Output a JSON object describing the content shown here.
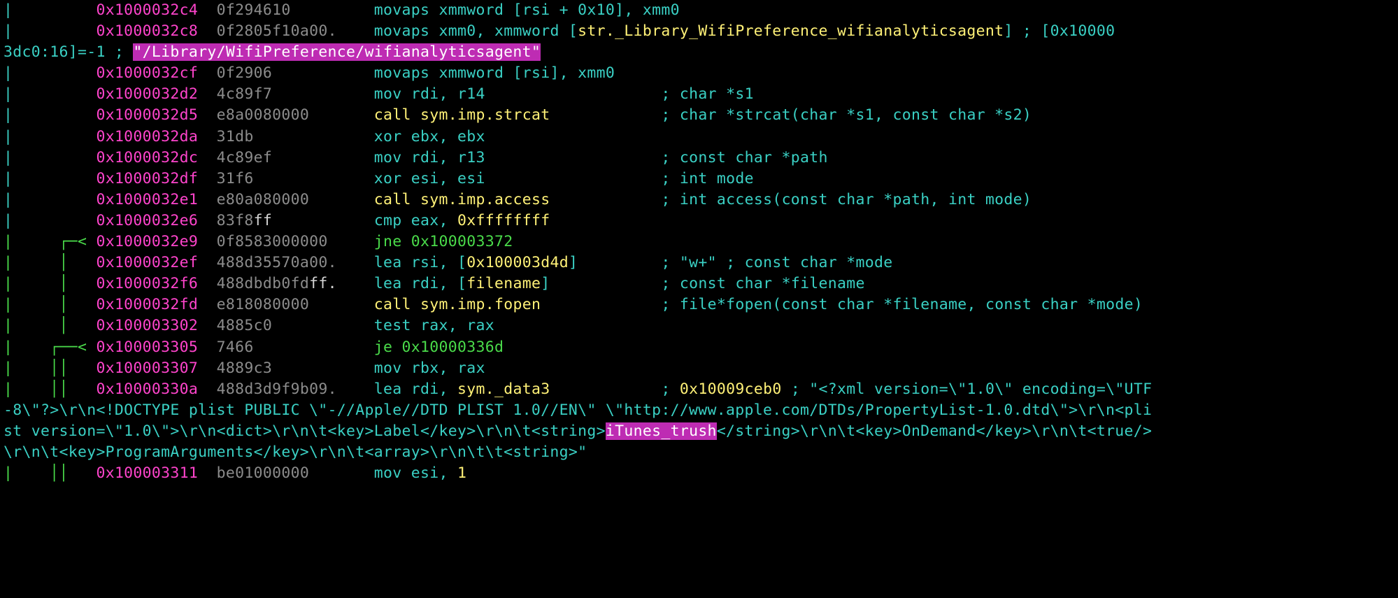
{
  "rows": [
    {
      "prefix": "|         ",
      "addr": "0x1000032c4",
      "bytes": "0f294610",
      "op": {
        "mnem": "movaps",
        "cls": "mnem",
        "rest": " xmmword [rsi + 0x10], xmm0"
      },
      "comment": ""
    },
    {
      "prefix": "|         ",
      "addr": "0x1000032c8",
      "bytes": "0f2805f10a00.",
      "op": {
        "mnem": "movaps",
        "cls": "mnem",
        "rest": " xmm0, xmmword [",
        "ref": "str._Library_WifiPreference_wifianalyticsagent",
        "close": "]"
      },
      "trailing": " ; [0x10000"
    },
    {
      "wrap": true,
      "text_a": "3dc0:16]=-1 ; ",
      "hl": "\"/Library/WifiPreference/wifianalyticsagent\""
    },
    {
      "prefix": "|         ",
      "addr": "0x1000032cf",
      "bytes": "0f2906",
      "op": {
        "mnem": "movaps",
        "cls": "mnem",
        "rest": " xmmword [rsi], xmm0"
      },
      "comment": ""
    },
    {
      "prefix": "|         ",
      "addr": "0x1000032d2",
      "bytes": "4c89f7",
      "op": {
        "mnem": "mov",
        "cls": "mnem",
        "rest": " rdi, r14"
      },
      "comment": "; char *s1"
    },
    {
      "prefix": "|         ",
      "addr": "0x1000032d5",
      "bytes": "e8a0080000",
      "op": {
        "mnem": "call",
        "cls": "call",
        "ref": "sym.imp.strcat"
      },
      "comment": "; char *strcat(char *s1, const char *s2)"
    },
    {
      "prefix": "|         ",
      "addr": "0x1000032da",
      "bytes": "31db",
      "op": {
        "mnem": "xor",
        "cls": "mnem",
        "rest": " ebx, ebx"
      },
      "comment": ""
    },
    {
      "prefix": "|         ",
      "addr": "0x1000032dc",
      "bytes": "4c89ef",
      "op": {
        "mnem": "mov",
        "cls": "mnem",
        "rest": " rdi, r13"
      },
      "comment": "; const char *path"
    },
    {
      "prefix": "|         ",
      "addr": "0x1000032df",
      "bytes": "31f6",
      "op": {
        "mnem": "xor",
        "cls": "mnem",
        "rest": " esi, esi"
      },
      "comment": "; int mode"
    },
    {
      "prefix": "|         ",
      "addr": "0x1000032e1",
      "bytes": "e80a080000",
      "op": {
        "mnem": "call",
        "cls": "call",
        "ref": "sym.imp.access"
      },
      "comment": "; int access(const char *path, int mode)"
    },
    {
      "prefix": "|         ",
      "addr": "0x1000032e6",
      "bytes_pre": "83f8",
      "bytes_bright": "ff",
      "op": {
        "mnem": "cmp",
        "cls": "mnem",
        "rest": " eax, ",
        "num": "0xffffffff"
      },
      "comment": ""
    },
    {
      "prefix": "|     ┌─< ",
      "prefix_cls": "jump",
      "addr": "0x1000032e9",
      "bytes": "0f8583000000",
      "op": {
        "mnem": "jne",
        "cls": "jump",
        "target": "0x100003372"
      },
      "comment": ""
    },
    {
      "prefix": "|     │   ",
      "prefix_cls": "jump",
      "addr": "0x1000032ef",
      "bytes": "488d35570a00.",
      "op": {
        "mnem": "lea",
        "cls": "mnem",
        "rest": " rsi, [",
        "num": "0x100003d4d",
        "close": "]"
      },
      "comment": "; \"w+\" ; const char *mode"
    },
    {
      "prefix": "|     │   ",
      "prefix_cls": "jump",
      "addr": "0x1000032f6",
      "bytes_pre": "488dbdb0fd",
      "bytes_bright": "ff.",
      "op": {
        "mnem": "lea",
        "cls": "mnem",
        "rest": " rdi, [",
        "ref": "filename",
        "close": "]"
      },
      "comment": "; const char *filename"
    },
    {
      "prefix": "|     │   ",
      "prefix_cls": "jump",
      "addr": "0x1000032fd",
      "bytes": "e818080000",
      "op": {
        "mnem": "call",
        "cls": "call",
        "ref": "sym.imp.fopen"
      },
      "comment": "; file*fopen(const char *filename, const char *mode)"
    },
    {
      "prefix": "|     │   ",
      "prefix_cls": "jump",
      "addr": "0x100003302",
      "bytes": "4885c0",
      "op": {
        "mnem": "test",
        "cls": "mnem",
        "rest": " rax, rax"
      },
      "comment": ""
    },
    {
      "prefix": "|    ┌──< ",
      "prefix_cls": "jump",
      "addr": "0x100003305",
      "bytes": "7466",
      "op": {
        "mnem": "je",
        "cls": "jump",
        "target": "0x10000336d"
      },
      "comment": ""
    },
    {
      "prefix": "|    ││   ",
      "prefix_cls": "jump",
      "addr": "0x100003307",
      "bytes": "4889c3",
      "op": {
        "mnem": "mov",
        "cls": "mnem",
        "rest": " rbx, rax"
      },
      "comment": ""
    },
    {
      "prefix": "|    ││   ",
      "prefix_cls": "jump",
      "addr": "0x10000330a",
      "bytes": "488d3d9f9b09.",
      "op": {
        "mnem": "lea",
        "cls": "mnem",
        "rest": " rdi, ",
        "ref": "sym._data3"
      },
      "long_comment_parts": [
        "; ",
        "0x10009ceb0",
        " ; \"<?xml version=\\\"1.0\\\" encoding=\\\"UTF"
      ]
    },
    {
      "wrap_multi": true,
      "text": "-8\\\"?>\\r\\n<!DOCTYPE plist PUBLIC \\\"-//Apple//DTD PLIST 1.0//EN\\\" \\\"http://www.apple.com/DTDs/PropertyList-1.0.dtd\\\">\\r\\n<pli"
    },
    {
      "wrap_multi": true,
      "text_a": "st version=\\\"1.0\\\">\\r\\n<dict>\\r\\n\\t<key>Label</key>\\r\\n\\t<string>",
      "hl": "iTunes_trush",
      "text_b": "</string>\\r\\n\\t<key>OnDemand</key>\\r\\n\\t<true/>"
    },
    {
      "wrap_multi": true,
      "text": "\\r\\n\\t<key>ProgramArguments</key>\\r\\n\\t<array>\\r\\n\\t\\t<string>\""
    },
    {
      "prefix": "|    ││   ",
      "prefix_cls": "jump",
      "addr": "0x100003311",
      "bytes": "be01000000",
      "op": {
        "mnem": "mov",
        "cls": "mnem",
        "rest": " esi, ",
        "num": "1"
      },
      "comment": ""
    }
  ],
  "cols": {
    "prefix": 10,
    "addr": 13,
    "bytes": 17,
    "mnem": 31
  }
}
